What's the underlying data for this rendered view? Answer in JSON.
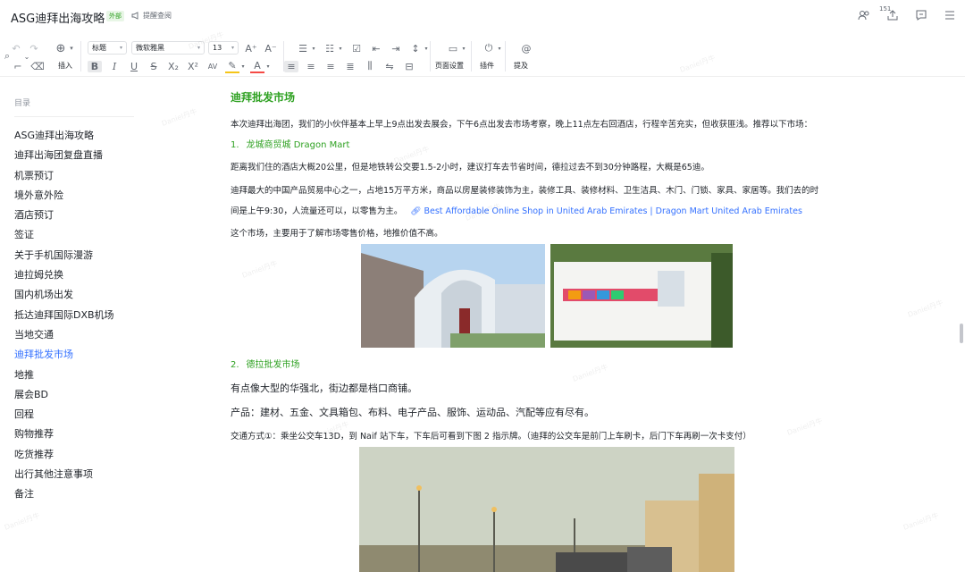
{
  "header": {
    "title": "ASG迪拜出海攻略",
    "badge": "外部",
    "remind": "提醒查阅",
    "count": "151"
  },
  "toolbar": {
    "insert_label": "插入",
    "style_value": "标题",
    "font_value": "微软雅黑",
    "size_value": "13",
    "page_settings_label": "页面设置",
    "plugin_label": "插件",
    "mention_label": "提及"
  },
  "sidebar": {
    "title": "目录",
    "items": [
      {
        "label": "ASG迪拜出海攻略"
      },
      {
        "label": "迪拜出海团复盘直播"
      },
      {
        "label": "机票预订"
      },
      {
        "label": "境外意外险"
      },
      {
        "label": "酒店预订"
      },
      {
        "label": "签证"
      },
      {
        "label": "关于手机国际漫游"
      },
      {
        "label": "迪拉姆兑换"
      },
      {
        "label": "国内机场出发"
      },
      {
        "label": "抵达迪拜国际DXB机场"
      },
      {
        "label": "当地交通"
      },
      {
        "label": "迪拜批发市场"
      },
      {
        "label": "地推"
      },
      {
        "label": "展会BD"
      },
      {
        "label": "回程"
      },
      {
        "label": "购物推荐"
      },
      {
        "label": "吃货推荐"
      },
      {
        "label": "出行其他注意事项"
      },
      {
        "label": "备注"
      }
    ],
    "active_index": 11
  },
  "content": {
    "heading": "迪拜批发市场",
    "intro": "本次迪拜出海团，我们的小伙伴基本上早上9点出发去展会，下午6点出发去市场考察，晚上11点左右回酒店，行程辛苦充实，但收获匪浅。推荐以下市场：",
    "item1_num": "1.",
    "item1_title": "龙城商贸城 Dragon Mart",
    "p1": "距离我们住的酒店大概20公里，但是地铁转公交要1.5-2小时，建议打车去节省时间，德拉过去不到30分钟路程，大概是65迪。",
    "p2a": "迪拜最大的中国产品贸易中心之一，占地15万平方米，商品以房屋装修装饰为主，装修工具、装修材料、卫生洁具、木门、门锁、家具、家居等。我们去的时",
    "p2b": "间是上午9:30，人流量还可以，以零售为主。",
    "link": "Best Affordable Online Shop in United Arab Emirates | Dragon Mart United Arab Emirates",
    "p3": "这个市场，主要用于了解市场零售价格，地推价值不高。",
    "item2_num": "2.",
    "item2_title": "德拉批发市场",
    "p4": "有点像大型的华强北，街边都是档口商铺。",
    "p5": "产品：建材、五金、文具箱包、布料、电子产品、服饰、运动品、汽配等应有尽有。",
    "p6": "交通方式①：乘坐公交车13D，到 Naif 站下车，下车后可看到下图 2 指示牌。（迪拜的公交车是前门上车刷卡，后门下车再刷一次卡支付）"
  },
  "watermark": "Daniel丹牛",
  "colors": {
    "accent_green": "#2ea121",
    "link_blue": "#3370ff"
  }
}
